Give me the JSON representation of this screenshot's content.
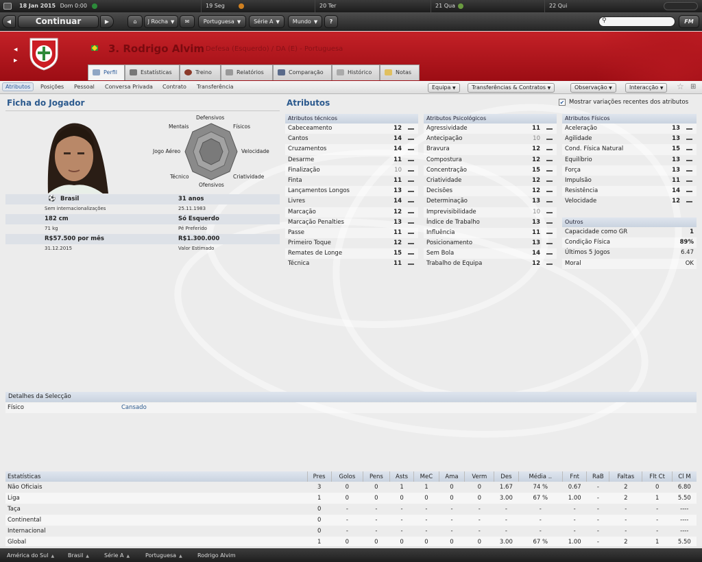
{
  "topbar": {
    "date": "18 Jan 2015",
    "day_time": "Dom 0:00",
    "days": [
      "19 Seg",
      "20 Ter",
      "21 Qua",
      "22 Qui"
    ]
  },
  "nav": {
    "continue_label": "Continuar",
    "menus": [
      "J Rocha",
      "Portuguesa",
      "Série A",
      "Mundo"
    ],
    "help": "?",
    "fm_label": "FM"
  },
  "player": {
    "number_name": "3. Rodrigo Alvim",
    "role": "Defesa (Esquerdo) / DA (E) - Portuguesa"
  },
  "tabs": [
    "Perfil",
    "Estatísticas",
    "Treino",
    "Relatórios",
    "Comparação",
    "Histórico",
    "Notas"
  ],
  "subnav": {
    "items": [
      "Atributos",
      "Posições",
      "Pessoal",
      "Conversa Privada",
      "Contrato",
      "Transferência"
    ],
    "buttons": [
      "Equipa",
      "Transferências & Contratos",
      "Observação",
      "Interacção"
    ]
  },
  "card": {
    "title": "Ficha do Jogador",
    "radar_labels": [
      "Defensivos",
      "Físicos",
      "Velocidade",
      "Criatividade",
      "Ofensivos",
      "Técnico",
      "Jogo Aéreo",
      "Mentais"
    ],
    "nationality": "Brasil",
    "caps": "Sem internacionalizações",
    "age": "31 anos",
    "dob": "25.11.1983",
    "height": "182 cm",
    "weight": "71 kg",
    "foot": "Só Esquerdo",
    "foot_label": "Pé Preferido",
    "wage": "R$57.500 por mês",
    "contract_end": "31.12.2015",
    "value": "R$1.300.000",
    "value_label": "Valor Estimado"
  },
  "attributes": {
    "title": "Atributos",
    "show_changes_label": "Mostrar variações recentes dos atributos",
    "technical_header": "Atributos técnicos",
    "technical": [
      {
        "name": "Cabeceamento",
        "value": "12"
      },
      {
        "name": "Cantos",
        "value": "14"
      },
      {
        "name": "Cruzamentos",
        "value": "14"
      },
      {
        "name": "Desarme",
        "value": "11"
      },
      {
        "name": "Finalização",
        "value": "10"
      },
      {
        "name": "Finta",
        "value": "11"
      },
      {
        "name": "Lançamentos Longos",
        "value": "13"
      },
      {
        "name": "Livres",
        "value": "14"
      },
      {
        "name": "Marcação",
        "value": "12"
      },
      {
        "name": "Marcação Penalties",
        "value": "13"
      },
      {
        "name": "Passe",
        "value": "11"
      },
      {
        "name": "Primeiro Toque",
        "value": "12"
      },
      {
        "name": "Remates de Longe",
        "value": "15"
      },
      {
        "name": "Técnica",
        "value": "11"
      }
    ],
    "mental_header": "Atributos Psicológicos",
    "mental": [
      {
        "name": "Agressividade",
        "value": "11"
      },
      {
        "name": "Antecipação",
        "value": "10"
      },
      {
        "name": "Bravura",
        "value": "12"
      },
      {
        "name": "Compostura",
        "value": "12"
      },
      {
        "name": "Concentração",
        "value": "15"
      },
      {
        "name": "Criatividade",
        "value": "12"
      },
      {
        "name": "Decisões",
        "value": "12"
      },
      {
        "name": "Determinação",
        "value": "13"
      },
      {
        "name": "Imprevisibilidade",
        "value": "10"
      },
      {
        "name": "Índice de Trabalho",
        "value": "13"
      },
      {
        "name": "Influência",
        "value": "11"
      },
      {
        "name": "Posicionamento",
        "value": "13"
      },
      {
        "name": "Sem Bola",
        "value": "14"
      },
      {
        "name": "Trabalho de Equipa",
        "value": "12"
      }
    ],
    "physical_header": "Atributos Físicos",
    "physical": [
      {
        "name": "Aceleração",
        "value": "13"
      },
      {
        "name": "Agilidade",
        "value": "13"
      },
      {
        "name": "Cond. Física Natural",
        "value": "15"
      },
      {
        "name": "Equilíbrio",
        "value": "13"
      },
      {
        "name": "Força",
        "value": "13"
      },
      {
        "name": "Impulsão",
        "value": "11"
      },
      {
        "name": "Resistência",
        "value": "14"
      },
      {
        "name": "Velocidade",
        "value": "12"
      }
    ],
    "other_header": "Outros",
    "other": [
      {
        "name": "Capacidade como GR",
        "value": "1"
      },
      {
        "name": "Condição Física",
        "value": "89%"
      },
      {
        "name": "Últimos 5 Jogos",
        "value": "6.47"
      },
      {
        "name": "Moral",
        "value": "OK"
      }
    ]
  },
  "selection": {
    "header": "Detalhes da Selecção",
    "label": "Físico",
    "value": "Cansado"
  },
  "stats": {
    "headers": [
      "Estatísticas",
      "Pres",
      "Golos",
      "Pens",
      "Asts",
      "MeC",
      "Ama",
      "Verm",
      "Des",
      "Média ..",
      "Fnt",
      "RaB",
      "Faltas",
      "Flt Ct",
      "Cl M"
    ],
    "rows": [
      [
        "Não Oficiais",
        "3",
        "0",
        "0",
        "1",
        "1",
        "0",
        "0",
        "1.67",
        "74 %",
        "0.67",
        "-",
        "2",
        "0",
        "6.80"
      ],
      [
        "Liga",
        "1",
        "0",
        "0",
        "0",
        "0",
        "0",
        "0",
        "3.00",
        "67 %",
        "1.00",
        "-",
        "2",
        "1",
        "5.50"
      ],
      [
        "Taça",
        "0",
        "-",
        "-",
        "-",
        "-",
        "-",
        "-",
        "-",
        "-",
        "-",
        "-",
        "-",
        "-",
        "----"
      ],
      [
        "Continental",
        "0",
        "-",
        "-",
        "-",
        "-",
        "-",
        "-",
        "-",
        "-",
        "-",
        "-",
        "-",
        "-",
        "----"
      ],
      [
        "Internacional",
        "0",
        "-",
        "-",
        "-",
        "-",
        "-",
        "-",
        "-",
        "-",
        "-",
        "-",
        "-",
        "-",
        "----"
      ],
      [
        "Global",
        "1",
        "0",
        "0",
        "0",
        "0",
        "0",
        "0",
        "3.00",
        "67 %",
        "1.00",
        "-",
        "2",
        "1",
        "5.50"
      ]
    ]
  },
  "breadcrumbs": [
    "América do Sul",
    "Brasil",
    "Série A",
    "Portuguesa",
    "Rodrigo Alvim"
  ]
}
